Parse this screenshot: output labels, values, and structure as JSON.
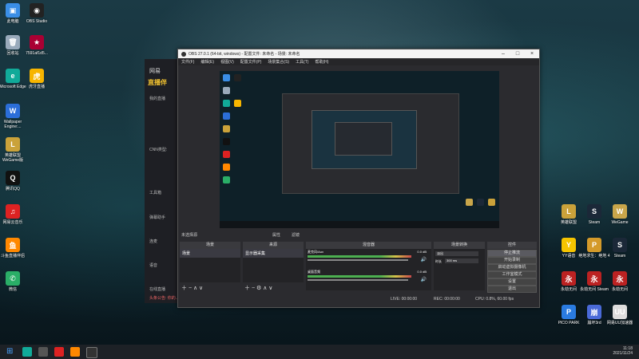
{
  "desktop_icons_left": [
    {
      "label": "此电脑",
      "color": "#3a8ee6",
      "glyph": "▣"
    },
    {
      "label": "OBS Studio",
      "color": "#222",
      "glyph": "◉"
    },
    {
      "label": "回收站",
      "color": "#9ab",
      "glyph": "🗑"
    },
    {
      "label": "7591af1d5...",
      "color": "#a03",
      "glyph": "★"
    },
    {
      "label": "Microsoft Edge",
      "color": "#1a9",
      "glyph": "e"
    },
    {
      "label": "虎牙直播",
      "color": "#f7b500",
      "glyph": "虎"
    },
    {
      "label": "Wallpaper Engine:...",
      "color": "#2b6ed8",
      "glyph": "W"
    },
    {
      "label": "英雄联盟 WeGame版",
      "color": "#caa23a",
      "glyph": "L"
    },
    {
      "label": "腾讯QQ",
      "color": "#111",
      "glyph": "Q"
    },
    {
      "label": "网易云音乐",
      "color": "#d22",
      "glyph": "♫"
    },
    {
      "label": "斗鱼直播伴侣",
      "color": "#f80",
      "glyph": "鱼"
    },
    {
      "label": "微信",
      "color": "#2aae67",
      "glyph": "✆"
    }
  ],
  "desktop_icons_right": [
    {
      "label": "英雄联盟",
      "color": "#caa23a",
      "glyph": "L"
    },
    {
      "label": "Steam",
      "color": "#1b2838",
      "glyph": "S"
    },
    {
      "label": "WeGame",
      "color": "#c9a64a",
      "glyph": "W"
    },
    {
      "label": "YY语音",
      "color": "#f5c400",
      "glyph": "Y"
    },
    {
      "label": "绝地求生：绝地 4",
      "color": "#d49a2a",
      "glyph": "P"
    },
    {
      "label": "Steam",
      "color": "#1b2838",
      "glyph": "S"
    },
    {
      "label": "永劫无间",
      "color": "#b22",
      "glyph": "永"
    },
    {
      "label": "永劫无间 Steam",
      "color": "#b22",
      "glyph": "永"
    },
    {
      "label": "永劫无间",
      "color": "#b22",
      "glyph": "永"
    },
    {
      "label": "PICO PARK",
      "color": "#2a7be0",
      "glyph": "P"
    },
    {
      "label": "崩坏3rd",
      "color": "#4a6ad8",
      "glyph": "崩"
    },
    {
      "label": "网易UU加速器",
      "color": "#ddd",
      "glyph": "UU"
    }
  ],
  "cc_app": {
    "logo": "网易",
    "brand": "直播伴",
    "side_items": [
      "我的直播",
      "CNN类型:",
      "工具箱",
      "弹幕助手",
      "连麦",
      "语音",
      "在线直播"
    ],
    "status": "头条公告: 你的..."
  },
  "obs": {
    "title": "OBS 27.0.1 (64-bit, windows) - 配置文件: 未命名 - 场景: 未命名",
    "menu": [
      "文件(F)",
      "编辑(E)",
      "视图(V)",
      "配置文件(P)",
      "场景集合(S)",
      "工具(T)",
      "帮助(H)"
    ],
    "no_source": "未选择源",
    "props_btn": "属性",
    "filter_btn": "滤镜",
    "panels": {
      "scenes": "场景",
      "sources": "来源",
      "mixer": "混音器",
      "transitions": "场景转换",
      "controls": "控件"
    },
    "scene_item": "场景",
    "source_item": "显示器采集",
    "mixer_tracks": [
      {
        "name": "麦克风/Aux",
        "db": "0.0 dB"
      },
      {
        "name": "桌面音频",
        "db": "0.0 dB"
      }
    ],
    "transition": {
      "type": "淡出",
      "duration_label": "时长",
      "duration": "300 ms"
    },
    "controls": [
      "停止推流",
      "开始录制",
      "启动虚拟摄像机",
      "工作室模式",
      "设置",
      "退出"
    ],
    "status": {
      "live": "LIVE: 00:00:00",
      "rec": "REC: 00:00:00",
      "cpu": "CPU: 0.8%, 60.00 fps"
    }
  },
  "taskbar": {
    "time": "11:18",
    "date": "2021/11/24"
  }
}
